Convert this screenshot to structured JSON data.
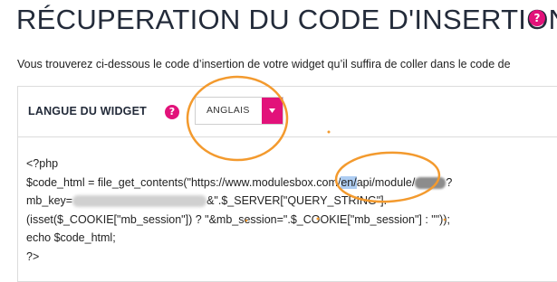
{
  "page": {
    "title": "RÉCUPERATION DU CODE D'INSERTION",
    "intro": "Vous trouverez ci-dessous le code d’insertion de votre widget qu’il suffira de coller dans le code de"
  },
  "widget_language": {
    "label": "LANGUE DU WIDGET",
    "selected": "ANGLAIS"
  },
  "code": {
    "line1": "<?php",
    "line2_prefix": "$code_html = file_get_contents(\"https://www.modulesbox.com/",
    "line2_highlight": "en/",
    "line2_suffix": "api/module/",
    "line2_end": "?",
    "line3_prefix": "mb_key=",
    "line3_suffix": "&\".$_SERVER[\"QUERY_STRING\"].",
    "line4": "(isset($_COOKIE[\"mb_session\"]) ? \"&mb_session=\".$_COOKIE[\"mb_session\"] : \"\"));",
    "line5": "echo $code_html;",
    "line6": "?>"
  },
  "colors": {
    "accent": "#e2127a",
    "annotation": "#f39a2e",
    "highlight": "#aecdf2"
  },
  "icons": {
    "help": "question-mark-circle-icon",
    "dropdown": "caret-down-icon"
  }
}
